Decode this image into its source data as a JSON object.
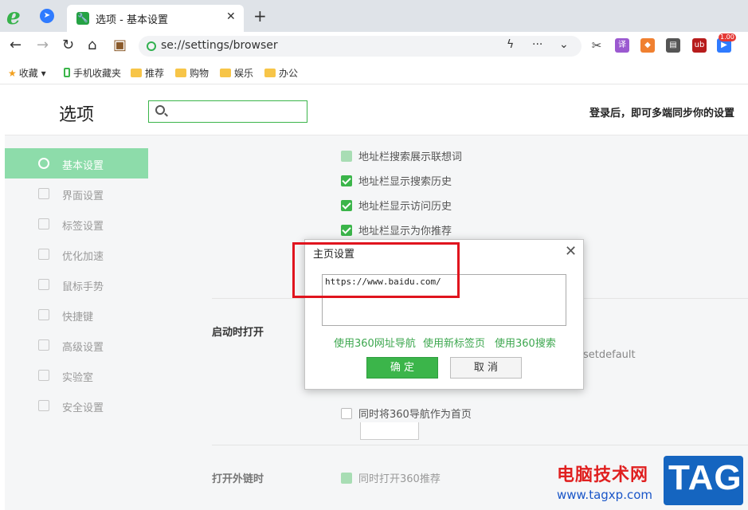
{
  "browser": {
    "tab_title": "选项 - 基本设置",
    "address": "se://settings/browser",
    "logo_letter": "e"
  },
  "extensions": [
    {
      "name": "scissors-icon",
      "color": "#444444"
    },
    {
      "name": "translate-icon",
      "label": "译",
      "color": "#9b59d0"
    },
    {
      "name": "game-icon",
      "color": "#f08030"
    },
    {
      "name": "book-icon",
      "color": "#555555"
    },
    {
      "name": "ublock-icon",
      "label": "ub",
      "color": "#b71c1c"
    },
    {
      "name": "play-icon",
      "badge": "1.00",
      "color": "#2f7bff"
    }
  ],
  "bookmarks": {
    "favorites": "收藏",
    "mobile": "手机收藏夹",
    "folders": [
      "推荐",
      "购物",
      "娱乐",
      "办公"
    ]
  },
  "settings": {
    "title": "选项",
    "sync_text": "登录后，即可多端同步你的设置",
    "sidebar": [
      "基本设置",
      "界面设置",
      "标签设置",
      "优化加速",
      "鼠标手势",
      "快捷键",
      "高级设置",
      "实验室",
      "安全设置"
    ],
    "checkboxes": [
      "地址栏搜索展示联想词",
      "地址栏显示搜索历史",
      "地址栏显示访问历史",
      "地址栏显示为你推荐"
    ],
    "startup_title": "启动时打开",
    "startup_faded_text": "setdefault",
    "homepage_360_option": "同时将360导航作为首页",
    "external_title": "打开外链时",
    "external_option": "同时打开360推荐"
  },
  "dialog": {
    "title": "主页设置",
    "url_value": "https://www.baidu.com/",
    "links": [
      "使用360网址导航",
      "使用新标签页",
      "使用360搜索"
    ],
    "ok": "确 定",
    "cancel": "取 消"
  },
  "watermark": {
    "cn": "电脑技术网",
    "url": "www.tagxp.com",
    "tag": "TAG"
  },
  "colors": {
    "accent": "#3bb54a",
    "highlight": "#e0141e"
  }
}
